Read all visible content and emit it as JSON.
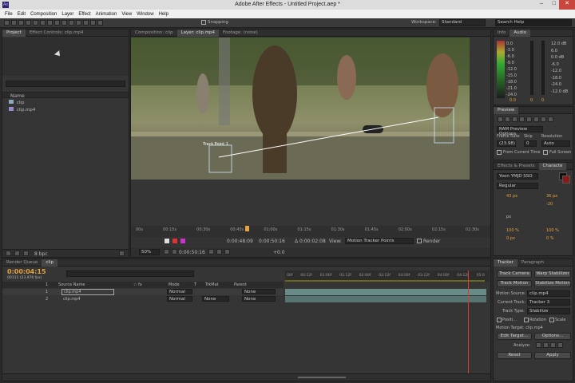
{
  "window": {
    "title": "Adobe After Effects - Untitled Project.aep *",
    "controls": [
      "–",
      "□",
      "✕"
    ]
  },
  "menu": [
    "File",
    "Edit",
    "Composition",
    "Layer",
    "Effect",
    "Animation",
    "View",
    "Window",
    "Help"
  ],
  "toolbar": {
    "snapping_label": "Snapping",
    "workspace_label": "Workspace:",
    "workspace_value": "Standard",
    "search_placeholder": "Search Help"
  },
  "project": {
    "tabs": [
      "Project",
      "Effect Controls: clip.mp4"
    ],
    "column_name": "Name",
    "items": [
      {
        "name": "clip",
        "type": "comp"
      },
      {
        "name": "clip.mp4",
        "type": "footage"
      }
    ],
    "bpc": "8 bpc"
  },
  "viewer": {
    "tabs": [
      "Composition: clip",
      "Layer: clip.mp4",
      "Footage: (none)"
    ],
    "track_point_label": "Track Point 1",
    "ruler_ticks": [
      "00s",
      "00:15s",
      "00:30s",
      "00:45s",
      "01:00s",
      "01:15s",
      "01:30s",
      "01:45s",
      "02:00s",
      "02:15s",
      "02:30s"
    ],
    "timecode_in": "0:00:48:09",
    "timecode_out": "0:00:50:16",
    "duration": "Δ 0:00:02:08",
    "view_label": "View:",
    "view_value": "Motion Tracker Points",
    "render_label": "Render",
    "zoom": "50%",
    "current_time": "0:00:50:16",
    "offset": "+0.0"
  },
  "info_audio": {
    "tabs": [
      "Info",
      "Audio"
    ],
    "db_scale": [
      "0.0",
      "-3.0",
      "-6.0",
      "-9.0",
      "-12.0",
      "-15.0",
      "-18.0",
      "-21.0",
      "-24.0"
    ],
    "db_right": [
      "12.0 dB",
      "6.0",
      "0.0 dB",
      "-6.0",
      "-12.0",
      "-18.0",
      "-24.0",
      "-12.0 dB"
    ],
    "values": [
      "0.0",
      "0",
      "0"
    ]
  },
  "preview": {
    "title": "Preview",
    "ram_option": "RAM Preview Options",
    "frame_rate_label": "Frame Rate",
    "skip_label": "Skip",
    "resolution_label": "Resolution",
    "frame_rate": "(23.98)",
    "skip": "0",
    "resolution": "Auto",
    "from_current": "From Current Time",
    "full_screen": "Full Screen"
  },
  "character": {
    "tabs": [
      "Effects & Presets",
      "Characte"
    ],
    "font": "Yoon YMJD SSO",
    "style": "Regular",
    "size": "43 px",
    "leading": "36 px",
    "kerning_value": "-20",
    "tracking": "px",
    "scale_v": "100 %",
    "scale_h": "100 %",
    "baseline": "0 px",
    "tsume": "0 %"
  },
  "tracker": {
    "tabs": [
      "Tracker",
      "Paragraph"
    ],
    "track_camera": "Track Camera",
    "warp_stabilizer": "Warp Stabilizer",
    "track_motion": "Track Motion",
    "stabilize_motion": "Stabilize Motion",
    "motion_source_label": "Motion Source:",
    "motion_source": "clip.mp4",
    "current_track_label": "Current Track:",
    "current_track": "Tracker 3",
    "track_type_label": "Track Type:",
    "track_type": "Stabilize",
    "position": "Positi...",
    "rotation": "Rotation",
    "scale": "Scale",
    "motion_target_label": "Motion Target: clip.mp4",
    "edit_target": "Edit Target...",
    "options": "Options...",
    "analyze_label": "Analyze:",
    "reset": "Reset",
    "apply": "Apply"
  },
  "timeline": {
    "tabs": [
      "Render Queue",
      "clip"
    ],
    "timecode": "0:00:04:15",
    "fps": "00111 (23.976 fps)",
    "col_source": "Source Name",
    "col_mode": "Mode",
    "col_trkmat": "TrkMat",
    "col_parent": "Parent",
    "col_switches": "☆ fx",
    "col_t": "T",
    "layers": [
      {
        "num": "1",
        "name": "clip.mp4",
        "mode": "Normal",
        "trkmat": "",
        "parent": "None"
      },
      {
        "num": "2",
        "name": "clip.mp4",
        "mode": "Normal",
        "trkmat": "None",
        "parent": "None"
      }
    ],
    "ruler": [
      "00f",
      "00:12f",
      "01:00f",
      "01:12f",
      "02:00f",
      "02:12f",
      "03:00f",
      "03:12f",
      "04:00f",
      "04:12f",
      "05:0"
    ]
  }
}
